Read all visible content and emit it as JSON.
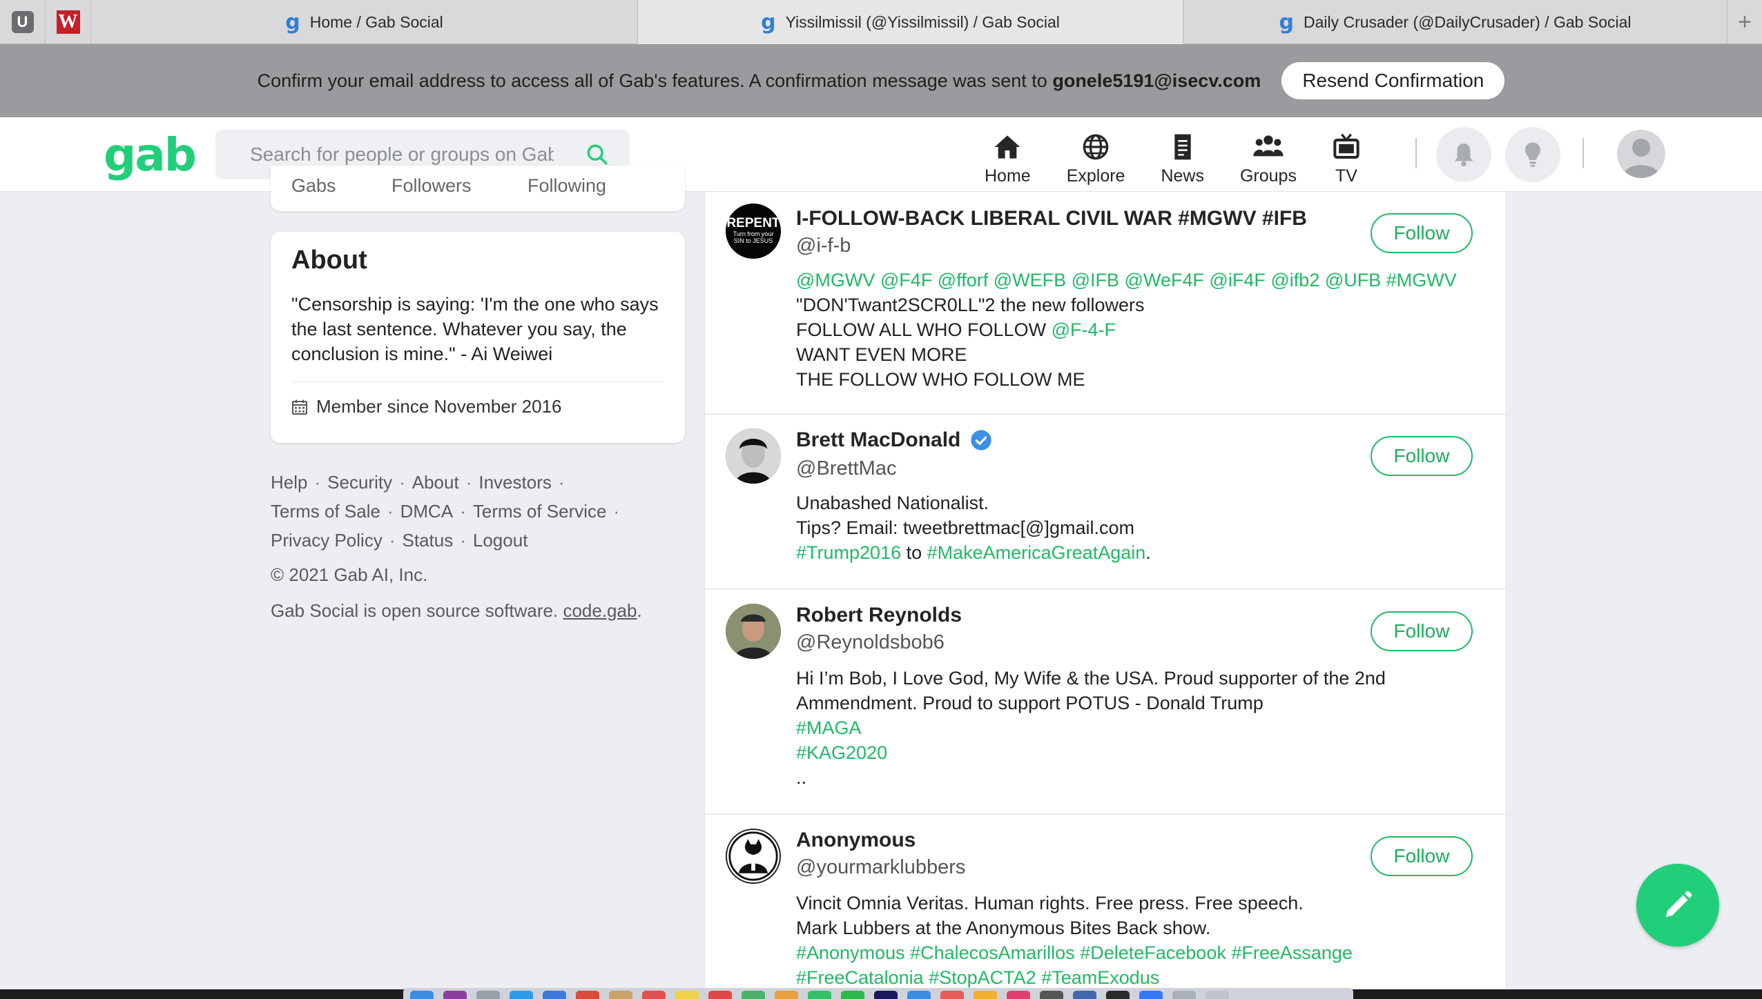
{
  "browser": {
    "pinned": [
      {
        "letter": "U"
      },
      {
        "letter": "W"
      }
    ],
    "tabs": [
      {
        "label": "Home / Gab Social",
        "active": false
      },
      {
        "label": "Yissilmissil (@Yissilmissil) / Gab Social",
        "active": true
      },
      {
        "label": "Daily Crusader (@DailyCrusader) / Gab Social",
        "active": false
      }
    ],
    "new_tab": "+"
  },
  "banner": {
    "message": "Confirm your email address to access all of Gab's features. A confirmation message was sent to ",
    "email": "gonele5191@isecv.com",
    "button": "Resend Confirmation"
  },
  "header": {
    "logo": "gab",
    "search_placeholder": "Search for people or groups on Gab",
    "nav": [
      {
        "label": "Home",
        "icon": "home-icon"
      },
      {
        "label": "Explore",
        "icon": "globe-icon"
      },
      {
        "label": "News",
        "icon": "news-icon"
      },
      {
        "label": "Groups",
        "icon": "groups-icon"
      },
      {
        "label": "TV",
        "icon": "tv-icon"
      }
    ],
    "accent": "#21cf7a"
  },
  "profile_stats": [
    "Gabs",
    "Followers",
    "Following"
  ],
  "about": {
    "title": "About",
    "quote": "\"Censorship is saying: 'I'm the one who says the last sentence. Whatever you say, the conclusion is mine.\" - Ai Weiwei",
    "member_since": "Member since November 2016"
  },
  "footer": {
    "links": [
      "Help",
      "Security",
      "About",
      "Investors",
      "Terms of Sale",
      "DMCA",
      "Terms of Service",
      "Privacy Policy",
      "Status",
      "Logout"
    ],
    "copyright": "© 2021 Gab AI, Inc.",
    "opensource_prefix": "Gab Social is open source software. ",
    "opensource_link": "code.gab",
    "opensource_suffix": "."
  },
  "users": [
    {
      "name": "I-FOLLOW-BACK LIBERAL CIVIL WAR #MGWV #IFB",
      "handle": "@i-f-b",
      "verified": false,
      "avatar_text": [
        "REPENT",
        "Turn from your",
        "SIN to JESUS"
      ],
      "bio_lines": [
        [
          {
            "t": "@MGWV @F4F @fforf @WEFB @IFB @WeF4F @iF4F @ifb2 @UFB #MGWV",
            "tag": true
          }
        ],
        [
          {
            "t": "\"DON'Twant2SCR0LL\"2 the new followers",
            "tag": false
          }
        ],
        [
          {
            "t": "FOLLOW ALL WHO FOLLOW ",
            "tag": false
          },
          {
            "t": "@F-4-F",
            "tag": true
          }
        ],
        [
          {
            "t": "WANT EVEN MORE",
            "tag": false
          }
        ],
        [
          {
            "t": "THE FOLLOW WHO FOLLOW ME",
            "tag": false
          }
        ]
      ],
      "follow": "Follow"
    },
    {
      "name": "Brett MacDonald",
      "handle": "@BrettMac",
      "verified": true,
      "bio_lines": [
        [
          {
            "t": "Unabashed Nationalist.",
            "tag": false
          }
        ],
        [
          {
            "t": "Tips? Email: tweetbrettmac[@]gmail.com",
            "tag": false
          }
        ],
        [
          {
            "t": "#Trump2016",
            "tag": true
          },
          {
            "t": " to ",
            "tag": false
          },
          {
            "t": "#MakeAmericaGreatAgain",
            "tag": true
          },
          {
            "t": ".",
            "tag": false
          }
        ]
      ],
      "follow": "Follow"
    },
    {
      "name": "Robert Reynolds",
      "handle": "@Reynoldsbob6",
      "verified": false,
      "bio_lines": [
        [
          {
            "t": "Hi I’m Bob, I Love God, My Wife & the USA. Proud supporter of the 2nd",
            "tag": false
          }
        ],
        [
          {
            "t": "Ammendment. Proud to support POTUS - Donald Trump",
            "tag": false
          }
        ],
        [
          {
            "t": "#MAGA",
            "tag": true
          }
        ],
        [
          {
            "t": "#KAG2020",
            "tag": true
          }
        ],
        [
          {
            "t": "..",
            "tag": false
          }
        ]
      ],
      "follow": "Follow"
    },
    {
      "name": "Anonymous",
      "handle": "@yourmarklubbers",
      "verified": false,
      "bio_lines": [
        [
          {
            "t": "Vincit Omnia Veritas. Human rights. Free press. Free speech.",
            "tag": false
          }
        ],
        [
          {
            "t": "Mark Lubbers at the Anonymous Bites Back show.",
            "tag": false
          }
        ],
        [
          {
            "t": "#Anonymous #ChalecosAmarillos #DeleteFacebook #FreeAssange",
            "tag": true
          }
        ],
        [
          {
            "t": "#FreeCatalonia #StopACTA2 #TeamExodus",
            "tag": true
          }
        ]
      ],
      "follow": "Follow"
    }
  ]
}
